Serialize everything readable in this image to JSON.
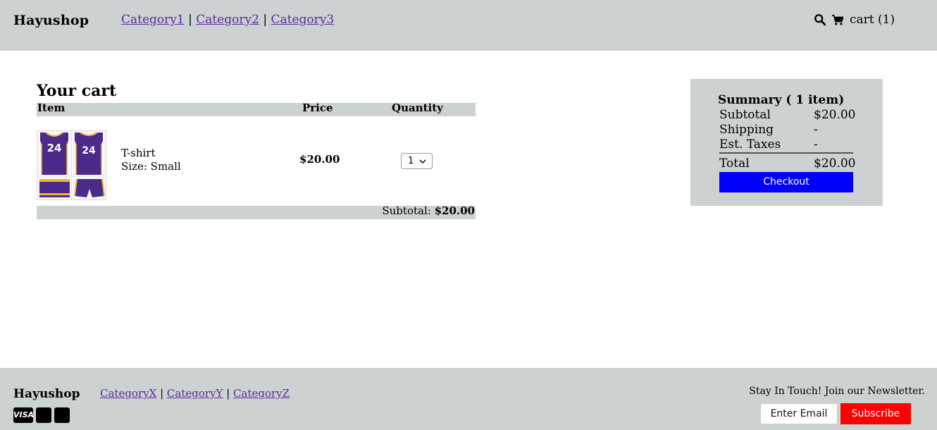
{
  "header": {
    "brand": "Hayushop",
    "nav": [
      "Category1",
      "Category2",
      "Category3"
    ],
    "nav_separator": "|",
    "icons": [
      "search-icon",
      "cart-icon"
    ],
    "cart_label": "cart (1)"
  },
  "cart": {
    "title": "Your cart",
    "columns": {
      "item": "Item",
      "price": "Price",
      "quantity": "Quantity"
    },
    "items": [
      {
        "name": "T-shirt",
        "size": "Size: Small",
        "price": "$20.00",
        "quantity": "1",
        "image": "purple-gold-basketball-jersey-24-thumbnail"
      }
    ],
    "subtotal_label": "Subtotal:",
    "subtotal_value": "$20.00"
  },
  "summary": {
    "title": "Summary ( 1 item)",
    "rows": [
      {
        "label": "Subtotal",
        "value": "$20.00"
      },
      {
        "label": "Shipping",
        "value": "-"
      },
      {
        "label": "Est. Taxes",
        "value": "-"
      }
    ],
    "total": {
      "label": "Total",
      "value": "$20.00"
    },
    "checkout_label": "Checkout",
    "checkout_color": "#0000ff"
  },
  "footer": {
    "brand": "Hayushop",
    "nav": [
      "CategoryX",
      "CategoryY",
      "CategoryZ"
    ],
    "nav_separator": "|",
    "payment_icons": [
      "visa-icon",
      "card-icon",
      "card-icon"
    ],
    "visa_label": "VISA",
    "newsletter_text": "Stay In Touch! Join our Newsletter.",
    "email_placeholder": "Enter Email",
    "subscribe_label": "Subscribe",
    "subscribe_color": "#ff0000"
  },
  "colors": {
    "bar_gray": "#ccd1d1",
    "link": "#5a2aa0"
  }
}
